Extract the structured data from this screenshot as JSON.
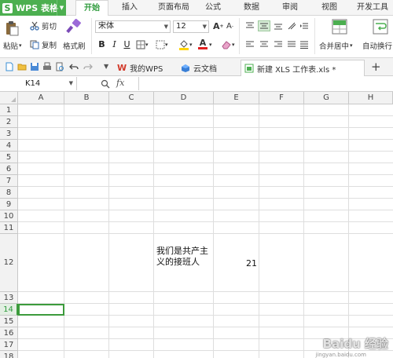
{
  "app": {
    "name": "WPS 表格",
    "logo": "S"
  },
  "menu_tabs": [
    "开始",
    "插入",
    "页面布局",
    "公式",
    "数据",
    "审阅",
    "视图",
    "开发工具"
  ],
  "ribbon": {
    "paste": "粘贴",
    "cut": "剪切",
    "copy": "复制",
    "format_painter": "格式刷",
    "font_name": "宋体",
    "font_size": "12",
    "bold": "B",
    "italic": "I",
    "underline": "U",
    "merge_center": "合并居中",
    "wrap_text": "自动换行"
  },
  "doc_tabs": [
    {
      "label": "我的WPS"
    },
    {
      "label": "云文档"
    },
    {
      "label": "新建 XLS 工作表.xls *"
    }
  ],
  "formula_bar": {
    "cell_ref": "K14",
    "fx": "fx",
    "value": ""
  },
  "columns": [
    "A",
    "B",
    "C",
    "D",
    "E",
    "F",
    "G",
    "H"
  ],
  "rows": [
    "1",
    "2",
    "3",
    "4",
    "5",
    "6",
    "7",
    "8",
    "9",
    "10",
    "11",
    "12",
    "13",
    "14",
    "15",
    "16",
    "17",
    "18"
  ],
  "active_row": "14",
  "cells": {
    "D12": "我们是共产主义的接班人",
    "E12": "21"
  },
  "watermark": {
    "text": "Baidu 经验",
    "sub": "jingyan.baidu.com"
  },
  "colors": {
    "accent": "#4caf50",
    "active_tab_text": "#2e9b3c"
  }
}
